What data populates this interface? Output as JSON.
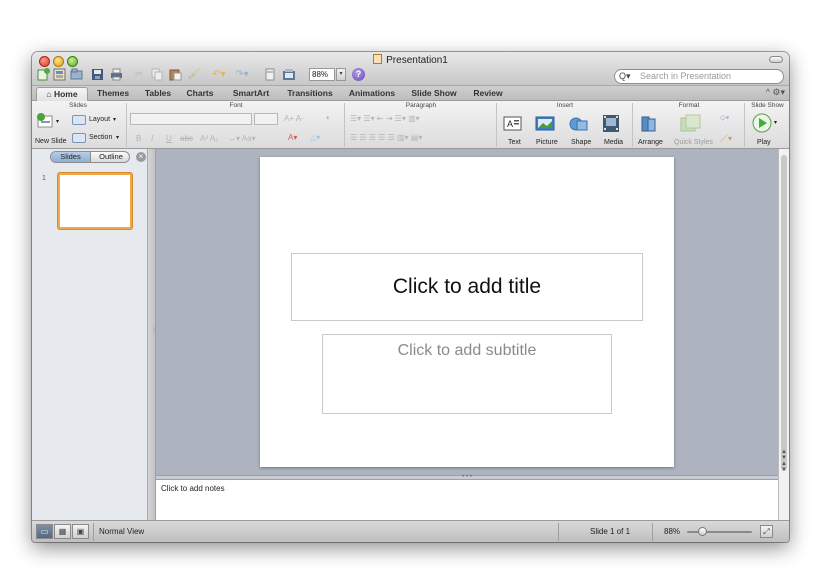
{
  "window": {
    "title": "Presentation1",
    "zoom_value": "88%",
    "search_placeholder": "Search in Presentation",
    "icons": [
      "traffic-close",
      "traffic-minimize",
      "traffic-zoom",
      "new-icon",
      "templates-icon",
      "open-icon",
      "save-icon",
      "print-icon",
      "cut-icon",
      "copy-icon",
      "paste-icon",
      "format-icon",
      "undo-icon",
      "redo-icon",
      "toolbox-icon",
      "media-browser-icon",
      "help-icon"
    ]
  },
  "tabs": [
    {
      "label": "Home",
      "icon": "home-icon"
    },
    {
      "label": "Themes"
    },
    {
      "label": "Tables"
    },
    {
      "label": "Charts"
    },
    {
      "label": "SmartArt"
    },
    {
      "label": "Transitions"
    },
    {
      "label": "Animations"
    },
    {
      "label": "Slide Show"
    },
    {
      "label": "Review"
    }
  ],
  "ribbon": {
    "groups": {
      "slides": "Slides",
      "font": "Font",
      "paragraph": "Paragraph",
      "insert": "Insert",
      "format": "Format",
      "slideshow": "Slide Show"
    },
    "slides": {
      "new_slide": "New Slide",
      "layout": "Layout",
      "section": "Section"
    },
    "insert": {
      "text": "Text",
      "picture": "Picture",
      "shape": "Shape",
      "media": "Media"
    },
    "format": {
      "arrange": "Arrange",
      "quick_styles": "Quick Styles"
    },
    "slideshow": {
      "play": "Play"
    },
    "colors": {
      "insert_blue": "#3a7fc4",
      "play_green": "#3fae3a"
    }
  },
  "left_panel": {
    "tab_slides": "Slides",
    "tab_outline": "Outline",
    "slide_number": "1"
  },
  "slide": {
    "title_placeholder": "Click to add title",
    "subtitle_placeholder": "Click to add subtitle"
  },
  "notes": {
    "placeholder": "Click to add notes"
  },
  "status_bar": {
    "view": "Normal View",
    "slide_counter": "Slide 1 of 1",
    "zoom": "88%",
    "zoom_level": 0.25
  }
}
